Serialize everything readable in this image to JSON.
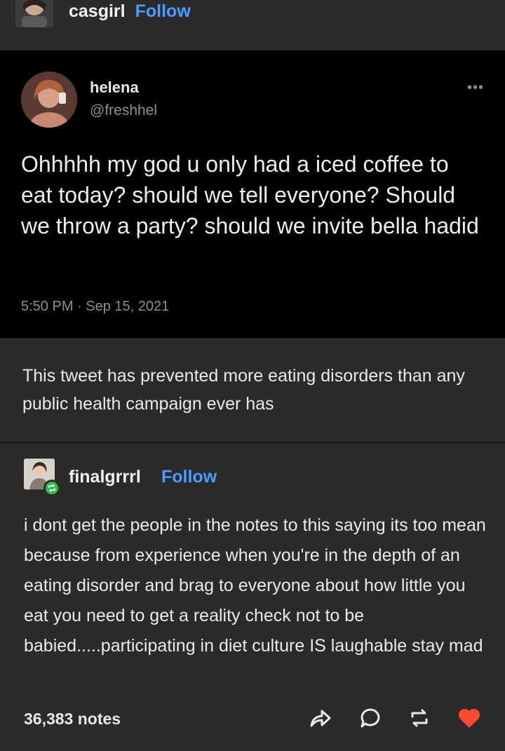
{
  "post": {
    "author": "casgirl",
    "follow_label": "Follow"
  },
  "tweet": {
    "name": "helena",
    "handle": "@freshhel",
    "text": "Ohhhhh my god u only had a iced coffee to eat today? should we tell everyone? Should we throw a party? should we invite bella hadid",
    "timestamp": "5:50 PM · Sep 15, 2021",
    "more_icon": "more-horizontal-icon"
  },
  "comment": "This tweet has prevented more eating disorders than any public health campaign ever has",
  "reblog": {
    "author": "finalgrrrl",
    "follow_label": "Follow",
    "badge_icon": "reblog-icon",
    "text": "i dont get the people in the notes to this saying its too mean because from experience when you're in the depth of an eating disorder and brag to everyone about how little you eat you need to get a reality check not to be babied.....participating in diet culture IS laughable stay mad"
  },
  "footer": {
    "notes": "36,383 notes",
    "actions": [
      "share-icon",
      "comment-icon",
      "reblog-icon",
      "heart-icon"
    ]
  },
  "colors": {
    "accent": "#4a9cff",
    "background": "#2b2b2b",
    "tweet_background": "#000000",
    "like": "#ff4930",
    "reblog_badge": "#2fbf4a"
  }
}
